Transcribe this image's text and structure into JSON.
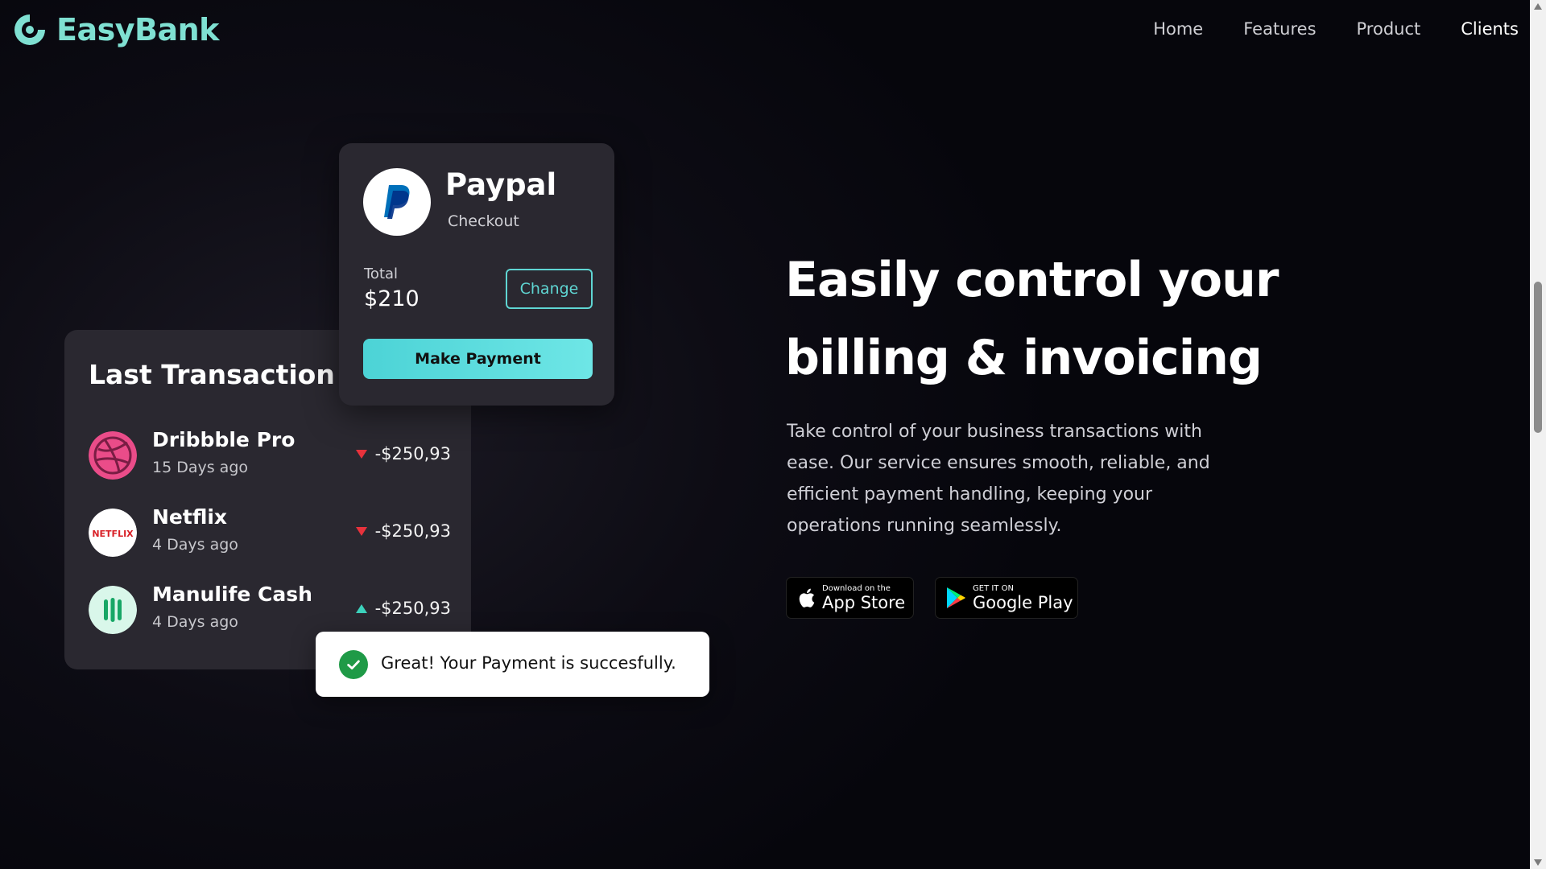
{
  "brand": {
    "name": "EasyBank",
    "accent": "#7fe0d2"
  },
  "nav": {
    "items": [
      {
        "label": "Home"
      },
      {
        "label": "Features"
      },
      {
        "label": "Product"
      },
      {
        "label": "Clients"
      }
    ],
    "active": "Clients"
  },
  "transactions": {
    "title": "Last Transaction",
    "items": [
      {
        "name": "Dribbble Pro",
        "date": "15 Days ago",
        "amount": "-$250,93",
        "trend": "down",
        "icon": "dribbble-icon"
      },
      {
        "name": "Netflix",
        "date": "4 Days ago",
        "amount": "-$250,93",
        "trend": "down",
        "icon": "netflix-icon",
        "logo_text": "NETFLIX"
      },
      {
        "name": "Manulife Cash",
        "date": "4 Days ago",
        "amount": "-$250,93",
        "trend": "up",
        "icon": "manulife-icon"
      }
    ]
  },
  "paypal": {
    "title": "Paypal",
    "subtitle": "Checkout",
    "total_label": "Total",
    "total": "$210",
    "change_label": "Change",
    "pay_label": "Make Payment"
  },
  "toast": {
    "message": "Great! Your Payment is succesfully."
  },
  "hero": {
    "title_line1": "Easily control your",
    "title_line2": "billing & invoicing",
    "description": "Take control of your business transactions with ease. Our service ensures smooth, reliable, and efficient payment handling, keeping your operations running seamlessly."
  },
  "stores": {
    "apple": {
      "small": "Download on the",
      "big": "App Store"
    },
    "google": {
      "small": "GET IT ON",
      "big": "Google Play"
    }
  }
}
